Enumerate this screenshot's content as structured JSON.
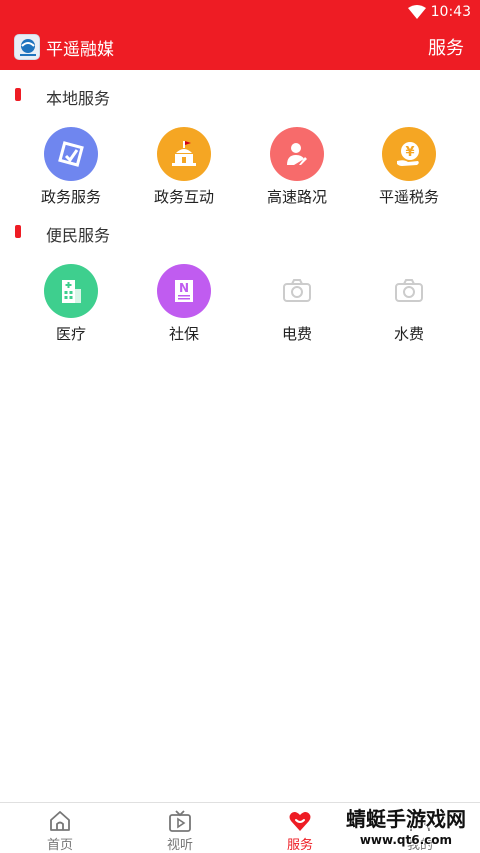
{
  "status_bar": {
    "time": "10:43",
    "wifi_icon": "wifi-icon"
  },
  "app_bar": {
    "app_name": "平遥融媒",
    "page_title": "服务",
    "logo_icon": "app-logo-icon"
  },
  "sections": [
    {
      "title": "本地服务",
      "items": [
        {
          "label": "政务服务",
          "icon": "gov-service-icon",
          "color": "#6f86ef"
        },
        {
          "label": "政务互动",
          "icon": "gov-building-icon",
          "color": "#f5a623"
        },
        {
          "label": "高速路况",
          "icon": "highway-status-icon",
          "color": "#f76b6b"
        },
        {
          "label": "平遥税务",
          "icon": "tax-yuan-icon",
          "color": "#f5a623"
        }
      ]
    },
    {
      "title": "便民服务",
      "items": [
        {
          "label": "医疗",
          "icon": "hospital-icon",
          "color": "#3ecf8e"
        },
        {
          "label": "社保",
          "icon": "social-security-icon",
          "color": "#c05cf0"
        },
        {
          "label": "电费",
          "icon": "camera-placeholder-icon",
          "color": "#cccccc"
        },
        {
          "label": "水费",
          "icon": "camera-placeholder-icon",
          "color": "#cccccc"
        }
      ]
    }
  ],
  "tab_bar": {
    "active_color": "#ee1c24",
    "tabs": [
      {
        "label": "首页",
        "icon": "home-icon",
        "active": false
      },
      {
        "label": "视听",
        "icon": "tv-play-icon",
        "active": false
      },
      {
        "label": "服务",
        "icon": "heart-icon",
        "active": true
      },
      {
        "label": "我的",
        "icon": "user-icon",
        "active": false
      }
    ]
  },
  "watermark": {
    "text": "蜻蜓手游戏网",
    "url": "www.qt6.com"
  }
}
